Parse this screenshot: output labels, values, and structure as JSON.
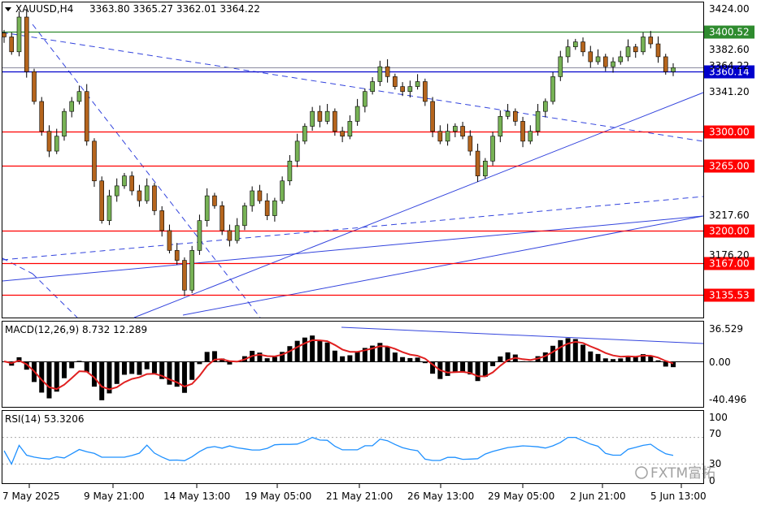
{
  "header": {
    "symbol": "XAUUSD,H4",
    "ohlc": "3363.80 3365.27 3362.01 3364.22"
  },
  "price_axis": {
    "ticks": [
      "3424.00",
      "3382.60",
      "3341.20",
      "3217.60",
      "3176.20"
    ],
    "current_price_label": "3364.22"
  },
  "levels": [
    {
      "label": "3400.52",
      "price": 3400.52,
      "color": "#2e8b2e"
    },
    {
      "label": "3360.14",
      "price": 3360.14,
      "color": "#0000cc"
    },
    {
      "label": "3300.00",
      "price": 3300.0,
      "color": "#ff0000"
    },
    {
      "label": "3265.00",
      "price": 3265.0,
      "color": "#ff0000"
    },
    {
      "label": "3200.00",
      "price": 3200.0,
      "color": "#ff0000"
    },
    {
      "label": "3167.00",
      "price": 3167.0,
      "color": "#ff0000"
    },
    {
      "label": "3135.53",
      "price": 3135.53,
      "color": "#ff0000"
    }
  ],
  "macd_panel": {
    "title": "MACD(12,26,9) 8.732 12.289",
    "ticks": [
      "36.529",
      "0.00",
      "-40.496"
    ]
  },
  "rsi_panel": {
    "title": "RSI(14) 53.3206",
    "ticks": [
      "100",
      "70",
      "30",
      "0"
    ]
  },
  "time_axis": {
    "labels": [
      "7 May 2025",
      "9 May 21:00",
      "14 May 13:00",
      "19 May 05:00",
      "21 May 21:00",
      "26 May 13:00",
      "29 May 05:00",
      "2 Jun 21:00",
      "5 Jun 13:00"
    ]
  },
  "watermark": "FXTM富拓",
  "colors": {
    "bull_candle": "#77b255",
    "bear_candle": "#b5651d",
    "trendline": "#3344dd",
    "signal_line": "#e02020",
    "rsi_line": "#1e90ff",
    "grid_bg": "#ffffff"
  },
  "chart_data": [
    {
      "type": "candlestick",
      "symbol": "XAUUSD",
      "timeframe": "H4",
      "ylim": [
        3128,
        3424
      ],
      "close_path": [
        3395,
        3380,
        3415,
        3360,
        3330,
        3300,
        3280,
        3295,
        3320,
        3330,
        3340,
        3290,
        3250,
        3210,
        3235,
        3245,
        3255,
        3240,
        3230,
        3245,
        3220,
        3200,
        3180,
        3170,
        3140,
        3180,
        3210,
        3235,
        3225,
        3200,
        3190,
        3205,
        3225,
        3240,
        3230,
        3215,
        3230,
        3250,
        3270,
        3290,
        3305,
        3320,
        3310,
        3320,
        3300,
        3295,
        3310,
        3325,
        3340,
        3350,
        3365,
        3355,
        3345,
        3340,
        3345,
        3350,
        3330,
        3300,
        3290,
        3300,
        3305,
        3295,
        3280,
        3255,
        3270,
        3295,
        3315,
        3320,
        3310,
        3290,
        3300,
        3320,
        3330,
        3355,
        3375,
        3385,
        3390,
        3380,
        3370,
        3375,
        3365,
        3370,
        3375,
        3385,
        3380,
        3395,
        3388,
        3375,
        3360,
        3364
      ],
      "current_price": 3364.22,
      "horizontal_levels": [
        3400.52,
        3360.14,
        3300.0,
        3265.0,
        3200.0,
        3167.0,
        3135.53
      ]
    },
    {
      "type": "bar",
      "name": "MACD(12,26,9)",
      "value": 8.732,
      "signal": 12.289,
      "ylim": [
        -40.496,
        36.529
      ]
    },
    {
      "type": "line",
      "name": "RSI(14)",
      "value": 53.3206,
      "levels": [
        70,
        30
      ],
      "ylim": [
        0,
        100
      ]
    }
  ]
}
